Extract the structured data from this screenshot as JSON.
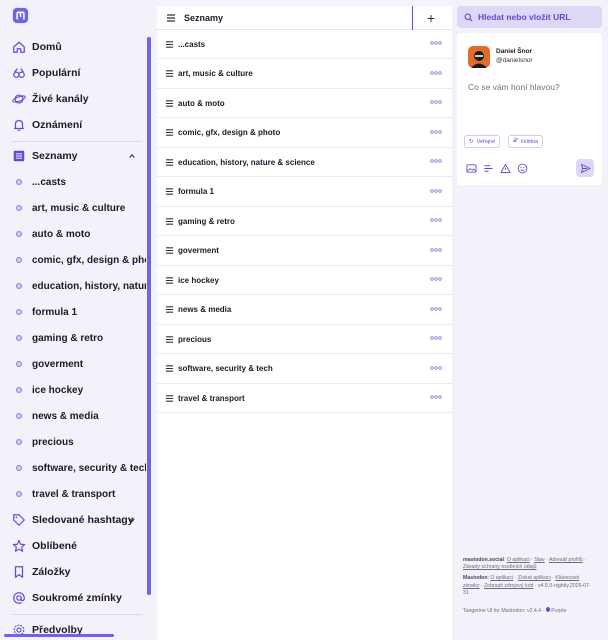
{
  "nav": {
    "items": [
      {
        "label": "Domů",
        "icon": "home-icon"
      },
      {
        "label": "Populární",
        "icon": "trending-icon"
      },
      {
        "label": "Živé kanály",
        "icon": "planet-icon"
      },
      {
        "label": "Oznámení",
        "icon": "bell-icon"
      }
    ],
    "lists_label": "Seznamy",
    "lists": [
      "...casts",
      "art, music & culture",
      "auto & moto",
      "comic, gfx, design & photo",
      "education, history, nature &",
      "formula 1",
      "gaming & retro",
      "goverment",
      "ice hockey",
      "news & media",
      "precious",
      "software, security & tech",
      "travel & transport"
    ],
    "bottom_items": [
      {
        "label": "Sledované hashtagy",
        "icon": "tag-icon"
      },
      {
        "label": "Oblíbené",
        "icon": "star-icon"
      },
      {
        "label": "Záložky",
        "icon": "bookmark-icon"
      },
      {
        "label": "Soukromé zmínky",
        "icon": "at-icon"
      },
      {
        "label": "Předvolby",
        "icon": "gear-icon"
      }
    ]
  },
  "lists_column": {
    "title": "Seznamy",
    "add_label": "+",
    "rows": [
      "...casts",
      "art, music & culture",
      "auto & moto",
      "comic, gfx, design & photo",
      "education, history, nature & science",
      "formula 1",
      "gaming & retro",
      "goverment",
      "ice hockey",
      "news & media",
      "precious",
      "software, security & tech",
      "travel & transport"
    ]
  },
  "search": {
    "placeholder": "Hledat nebo vložit URL"
  },
  "compose": {
    "name": "Daniel Šnor",
    "handle": "@danielsnor",
    "placeholder": "Co se vám honí hlavou?",
    "visibility": "Veřejné",
    "language": "čeština"
  },
  "footer": {
    "server": "mastodon.social",
    "server_links": [
      "O aplikaci",
      "Stav",
      "Adresář profilů",
      "Zásady ochrany osobních údajů"
    ],
    "app": "Mastodon",
    "app_links": [
      "O aplikaci",
      "Získat aplikaci",
      "Klávesové zkratky",
      "Zobrazit zdrojový kód"
    ],
    "version": "v4.5.0-nightly.2025-07-31",
    "theme": "Tangerine UI for Mastodon: v2.4.4",
    "theme_variant": "Purple"
  },
  "colors": {
    "accent": "#5b4fd1",
    "background": "#f3f1f9",
    "avatar": "#e26b2e"
  }
}
